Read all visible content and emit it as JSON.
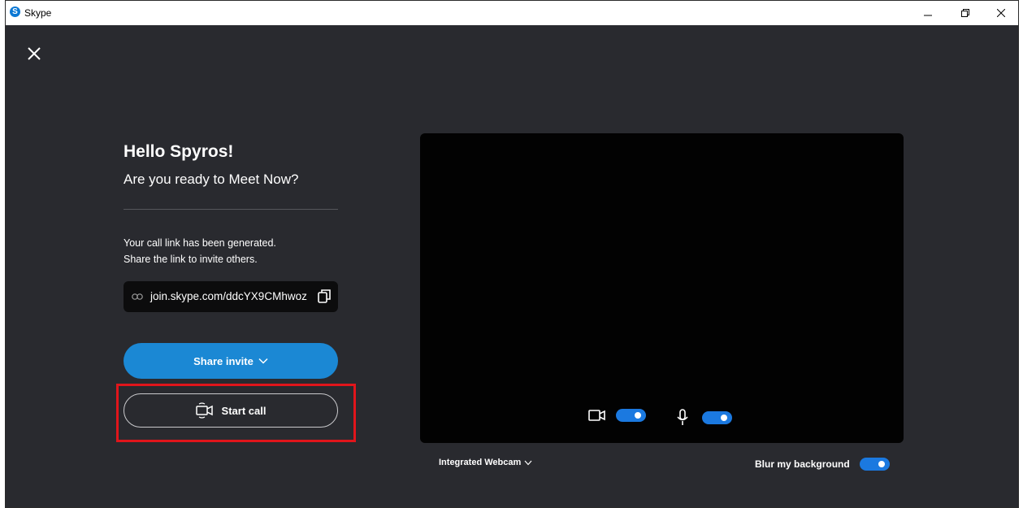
{
  "window": {
    "title": "Skype",
    "logo_letter": "S"
  },
  "greeting": {
    "hello": "Hello Spyros!",
    "ready": "Are you ready to Meet Now?"
  },
  "link_message": {
    "line1": "Your call link has been generated.",
    "line2": "Share the link to invite others."
  },
  "call_link": "join.skype.com/ddcYX9CMhwoz",
  "buttons": {
    "share_invite": "Share invite",
    "start_call": "Start call"
  },
  "devices": {
    "webcam": "Integrated Webcam",
    "blur_label": "Blur my background"
  },
  "toggles": {
    "video_on": true,
    "mic_on": true,
    "blur_on": true
  },
  "colors": {
    "accent": "#1b88d4",
    "toggle": "#1b79e0",
    "highlight": "#e0151b",
    "background": "#292a2f"
  }
}
